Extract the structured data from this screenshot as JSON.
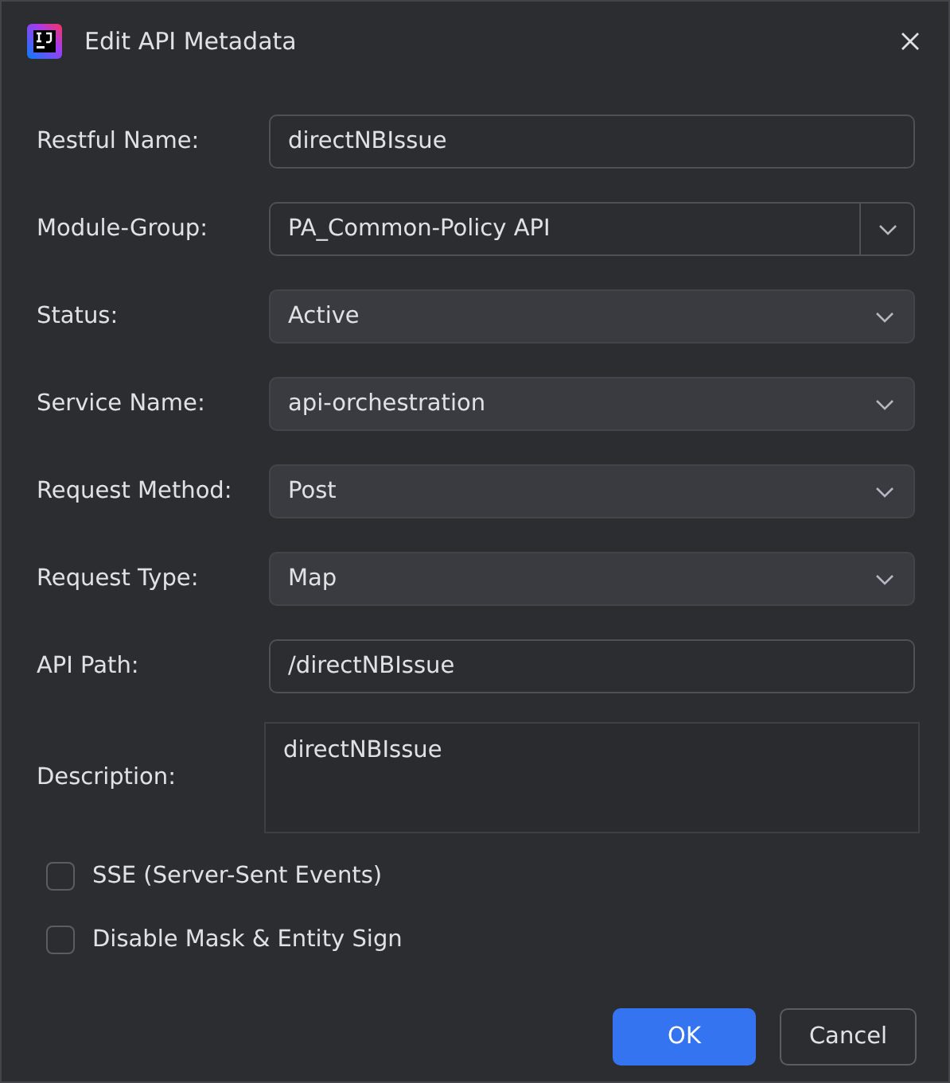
{
  "window": {
    "title": "Edit API Metadata"
  },
  "fields": [
    {
      "label": "Restful Name:",
      "kind": "text",
      "value": "directNBIssue"
    },
    {
      "label": "Module-Group:",
      "kind": "combo",
      "value": "PA_Common-Policy API"
    },
    {
      "label": "Status:",
      "kind": "select",
      "value": "Active"
    },
    {
      "label": "Service Name:",
      "kind": "select",
      "value": "api-orchestration"
    },
    {
      "label": "Request Method:",
      "kind": "select",
      "value": "Post"
    },
    {
      "label": "Request Type:",
      "kind": "select",
      "value": "Map"
    },
    {
      "label": "API Path:",
      "kind": "text",
      "value": "/directNBIssue"
    },
    {
      "label": "Description:",
      "kind": "textarea",
      "value": "directNBIssue"
    }
  ],
  "checkboxes": [
    {
      "label": "SSE (Server-Sent Events)",
      "checked": false
    },
    {
      "label": "Disable Mask & Entity Sign",
      "checked": false
    }
  ],
  "buttons": [
    {
      "label": "OK",
      "kind": "primary"
    },
    {
      "label": "Cancel",
      "kind": "secondary"
    }
  ]
}
